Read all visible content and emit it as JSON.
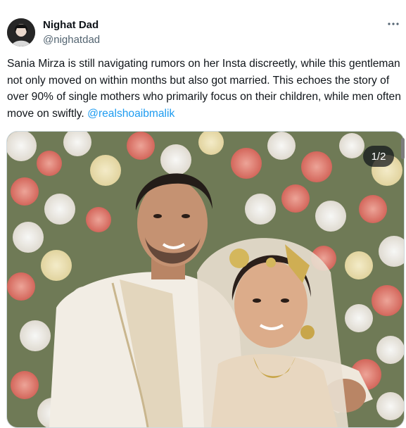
{
  "tweet": {
    "author": {
      "display_name": "Nighat Dad",
      "handle": "@nighatdad",
      "avatar_icon": "profile-photo-avatar"
    },
    "more_icon": "more-horizontal-icon",
    "text": {
      "body": "Sania Mirza is still navigating rumors on her Insta discreetly, while this gentleman not only moved on within months but also got married. This echoes the story of over 90% of single mothers who primarily focus on their children, while men often move on swiftly. ",
      "mention": "@realshoaibmalik"
    },
    "media": {
      "counter": "1/2",
      "description_icon": "wedding-photo-image"
    }
  },
  "colors": {
    "text_primary": "#0f1419",
    "text_secondary": "#536471",
    "link": "#1d9bf0",
    "border": "#cfd9de"
  }
}
